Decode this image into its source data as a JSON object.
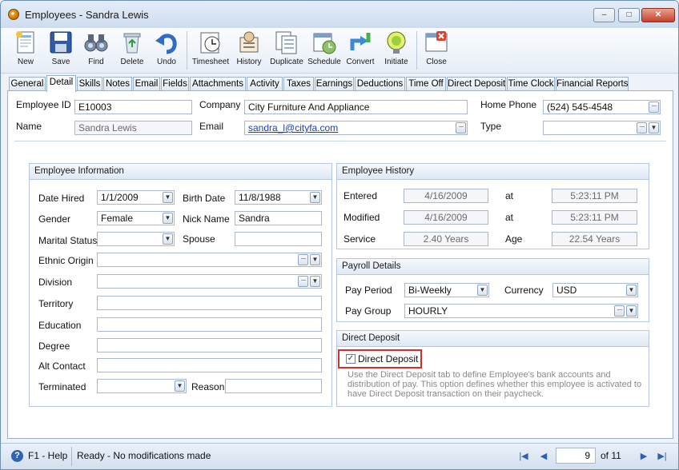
{
  "window": {
    "title": "Employees - Sandra Lewis",
    "min": "–",
    "max": "□",
    "close": "✕"
  },
  "toolbar": [
    {
      "label": "New",
      "icon": "new-document-icon"
    },
    {
      "label": "Save",
      "icon": "save-disk-icon"
    },
    {
      "label": "Find",
      "icon": "binoculars-icon"
    },
    {
      "label": "Delete",
      "icon": "recycle-bin-icon"
    },
    {
      "label": "Undo",
      "icon": "undo-arrow-icon"
    },
    {
      "label": "Timesheet",
      "icon": "timesheet-icon"
    },
    {
      "label": "History",
      "icon": "history-icon"
    },
    {
      "label": "Duplicate",
      "icon": "duplicate-icon"
    },
    {
      "label": "Schedule",
      "icon": "schedule-icon"
    },
    {
      "label": "Convert",
      "icon": "convert-icon"
    },
    {
      "label": "Initiate",
      "icon": "initiate-icon"
    },
    {
      "label": "Close",
      "icon": "close-window-icon"
    }
  ],
  "tabs": [
    "General",
    "Detail",
    "Skills",
    "Notes",
    "Email",
    "Fields",
    "Attachments",
    "Activity",
    "Taxes",
    "Earnings",
    "Deductions",
    "Time Off",
    "Direct Deposit",
    "Time Clock",
    "Financial Reports"
  ],
  "active_tab": "Detail",
  "header": {
    "employee_id_label": "Employee ID",
    "employee_id": "E10003",
    "company_label": "Company",
    "company": "City Furniture And Appliance",
    "home_phone_label": "Home Phone",
    "home_phone": "(524) 545-4548",
    "name_label": "Name",
    "name": "Sandra Lewis",
    "email_label": "Email",
    "email": "sandra_l@cityfa.com",
    "type_label": "Type",
    "type": ""
  },
  "employee_info": {
    "title": "Employee Information",
    "date_hired_label": "Date Hired",
    "date_hired": "1/1/2009",
    "birth_date_label": "Birth Date",
    "birth_date": "11/8/1988",
    "gender_label": "Gender",
    "gender": "Female",
    "nick_name_label": "Nick Name",
    "nick_name": "Sandra",
    "marital_status_label": "Marital Status",
    "marital_status": "",
    "spouse_label": "Spouse",
    "spouse": "",
    "ethnic_origin_label": "Ethnic Origin",
    "ethnic_origin": "",
    "division_label": "Division",
    "division": "",
    "territory_label": "Territory",
    "territory": "",
    "education_label": "Education",
    "education": "",
    "degree_label": "Degree",
    "degree": "",
    "alt_contact_label": "Alt Contact",
    "alt_contact": "",
    "terminated_label": "Terminated",
    "terminated": "",
    "reason_label": "Reason",
    "reason": ""
  },
  "history": {
    "title": "Employee History",
    "entered_label": "Entered",
    "entered": "4/16/2009",
    "entered_at_label": "at",
    "entered_time": "5:23:11 PM",
    "modified_label": "Modified",
    "modified": "4/16/2009",
    "modified_at_label": "at",
    "modified_time": "5:23:11 PM",
    "service_label": "Service",
    "service": "2.40 Years",
    "age_label": "Age",
    "age": "22.54 Years"
  },
  "payroll": {
    "title": "Payroll Details",
    "pay_period_label": "Pay Period",
    "pay_period": "Bi-Weekly",
    "currency_label": "Currency",
    "currency": "USD",
    "pay_group_label": "Pay Group",
    "pay_group": "HOURLY"
  },
  "direct_deposit": {
    "title": "Direct Deposit",
    "checkbox_label": "Direct Deposit",
    "checked": true,
    "description": "Use the Direct Deposit tab to define Employee's bank accounts and distribution of pay. This option defines whether this employee is activated to have Direct Deposit transaction on their paycheck.",
    "highlight_color": "#d0302a"
  },
  "status": {
    "help": "F1 - Help",
    "message": "Ready - No modifications made",
    "page": "9",
    "of_label": "of 11"
  }
}
